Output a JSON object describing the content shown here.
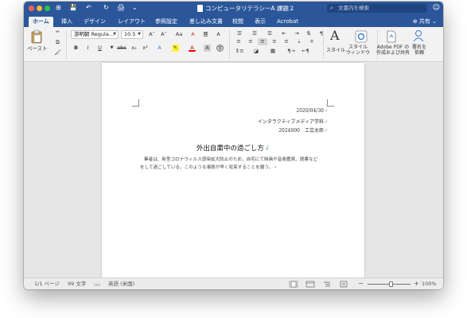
{
  "window": {
    "title": "コンピュータリテラシーA 課題２",
    "search_placeholder": "文書内を検索",
    "quick_access": [
      "⊞",
      "💾",
      "↶",
      "↻",
      "🖨",
      "⌄"
    ]
  },
  "tabs": [
    "ホーム",
    "挿入",
    "デザイン",
    "レイアウト",
    "参照設定",
    "差し込み文書",
    "校閲",
    "表示",
    "Acrobat"
  ],
  "share_label": "共有",
  "ribbon": {
    "paste_label": "ペースト",
    "font_name": "游明朝 Regula...",
    "font_size": "10.5",
    "style_label": "スタイル",
    "style_window_label": "スタイル\nウィンドウ",
    "adobe_label": "Adobe PDF の\n作成および共有",
    "sign_label": "署名を\n依頼"
  },
  "document": {
    "date": "2020/04/30",
    "department": "インタラクティブメディア学科",
    "id_name": "2024000　工芸太郎",
    "title": "外出自粛中の過ごし方",
    "body_line1": "筆者は、新型コロナウィルス感染拡大防止のため、自宅にて映画や音楽鑑賞、読書など",
    "body_line2": "をして過ごしている。このような事態が早く収束することを願う。"
  },
  "status": {
    "page": "1/1 ページ",
    "word_count": "99 文字",
    "language": "英語 (米国)",
    "zoom": "100%",
    "zoom_level": 0.55
  },
  "colors": {
    "word_blue": "#2b579a",
    "ribbon_bg": "#f2f2f2",
    "canvas_bg": "#e6e6e6"
  }
}
